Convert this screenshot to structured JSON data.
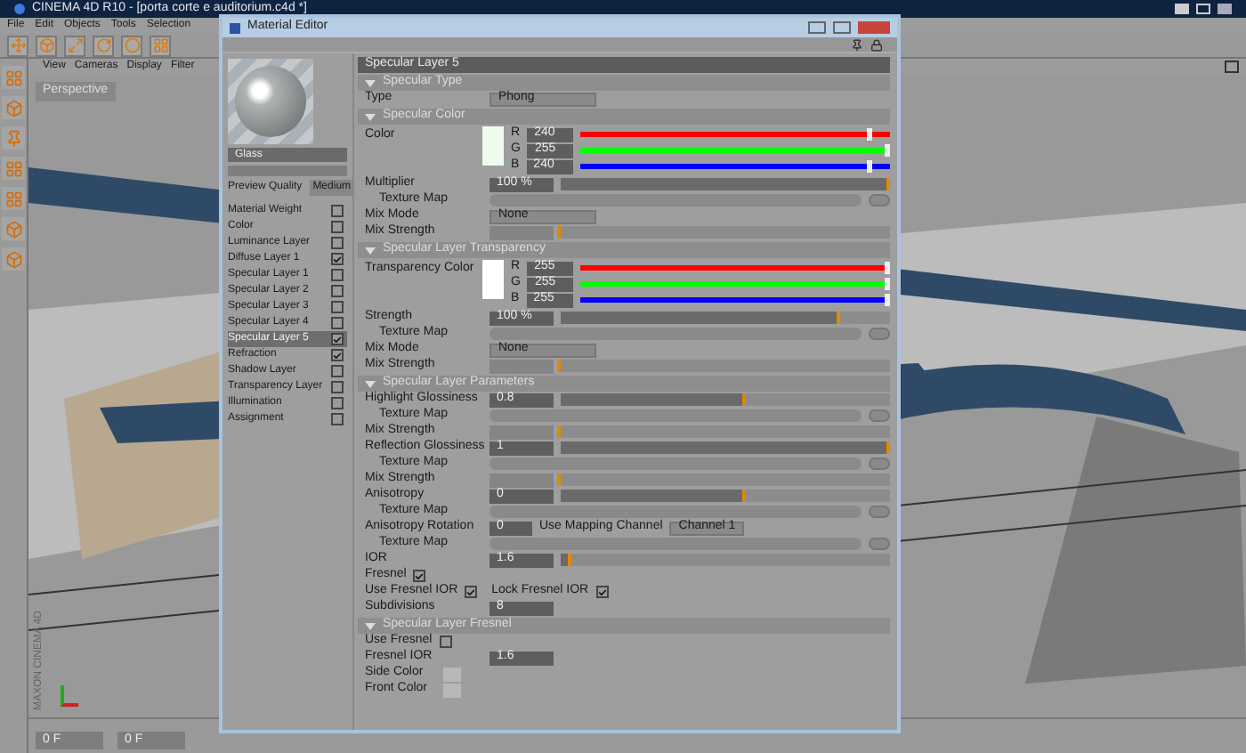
{
  "app": {
    "title": "CINEMA 4D R10 - [porta corte e auditorium.c4d *]",
    "menu": [
      "File",
      "Edit",
      "Objects",
      "Tools",
      "Selection"
    ]
  },
  "viewport": {
    "menu": [
      "View",
      "Cameras",
      "Display",
      "Filter"
    ],
    "label": "Perspective",
    "logo": "MAXON CINEMA 4D"
  },
  "timeline": {
    "current_frame": "0 F",
    "field_2": "0 F"
  },
  "editor": {
    "title": "Material Editor"
  },
  "preview": {
    "name": "Glass",
    "quality_label": "Preview Quality",
    "quality": "Medium"
  },
  "channels": [
    {
      "label": "Material Weight",
      "checked": false,
      "selected": false
    },
    {
      "label": "Color",
      "checked": false,
      "selected": false
    },
    {
      "label": "Luminance Layer",
      "checked": false,
      "selected": false
    },
    {
      "label": "Diffuse Layer 1",
      "checked": true,
      "selected": false
    },
    {
      "label": "Specular Layer 1",
      "checked": false,
      "selected": false
    },
    {
      "label": "Specular Layer 2",
      "checked": false,
      "selected": false
    },
    {
      "label": "Specular Layer 3",
      "checked": false,
      "selected": false
    },
    {
      "label": "Specular Layer 4",
      "checked": false,
      "selected": false
    },
    {
      "label": "Specular Layer 5",
      "checked": true,
      "selected": true
    },
    {
      "label": "Refraction",
      "checked": true,
      "selected": false
    },
    {
      "label": "Shadow Layer",
      "checked": false,
      "selected": false
    },
    {
      "label": "Transparency Layer",
      "checked": false,
      "selected": false
    },
    {
      "label": "Illumination",
      "checked": false,
      "selected": false
    },
    {
      "label": "Assignment",
      "checked": false,
      "selected": false
    }
  ],
  "panel": {
    "rows": [
      {
        "kind": "header",
        "label": "Specular Layer 5"
      },
      {
        "kind": "section",
        "label": "Specular Type"
      },
      {
        "kind": "dropdown",
        "label": "Type",
        "value": "Phong"
      },
      {
        "kind": "section",
        "label": "Specular Color"
      },
      {
        "kind": "color",
        "label": "Color",
        "color": "#eefcee",
        "channels": [
          {
            "name": "R",
            "value": "240",
            "level": 0.94,
            "color": "#ff0000"
          },
          {
            "name": "G",
            "value": "255",
            "level": 1,
            "color": "#00ff00"
          },
          {
            "name": "B",
            "value": "240",
            "level": 0.94,
            "color": "#0000ff"
          }
        ]
      },
      {
        "kind": "slider",
        "label": "Multiplier",
        "value": "100 %",
        "level": 1
      },
      {
        "kind": "texture",
        "label": "Texture Map"
      },
      {
        "kind": "dropdown",
        "label": "Mix Mode",
        "value": "None"
      },
      {
        "kind": "slider",
        "label": "Mix Strength",
        "level": 0
      },
      {
        "kind": "section",
        "label": "Specular Layer Transparency"
      },
      {
        "kind": "color",
        "label": "Transparency Color",
        "color": "#ffffff",
        "channels": [
          {
            "name": "R",
            "value": "255",
            "level": 1,
            "color": "#ff0000"
          },
          {
            "name": "G",
            "value": "255",
            "level": 1,
            "color": "#00ff00"
          },
          {
            "name": "B",
            "value": "255",
            "level": 1,
            "color": "#0000ff"
          }
        ]
      },
      {
        "kind": "slider",
        "label": "Strength",
        "value": "100 %",
        "level": 0.85
      },
      {
        "kind": "texture",
        "label": "Texture Map"
      },
      {
        "kind": "dropdown",
        "label": "Mix Mode",
        "value": "None"
      },
      {
        "kind": "slider",
        "label": "Mix Strength",
        "level": 0
      },
      {
        "kind": "section",
        "label": "Specular Layer Parameters"
      },
      {
        "kind": "slider",
        "label": "Highlight Glossiness",
        "value": "0.8",
        "level": 0.56
      },
      {
        "kind": "texture",
        "label": "Texture Map"
      },
      {
        "kind": "slider",
        "label": "Mix Strength",
        "level": 0
      },
      {
        "kind": "slider",
        "label": "Reflection Glossiness",
        "value": "1",
        "level": 1
      },
      {
        "kind": "texture",
        "label": "Texture Map"
      },
      {
        "kind": "slider",
        "label": "Mix Strength",
        "level": 0
      },
      {
        "kind": "slider",
        "label": "Anisotropy",
        "value": "0",
        "level": 0.56
      },
      {
        "kind": "texture",
        "label": "Texture Map"
      },
      {
        "kind": "pair",
        "label": "Anisotropy Rotation",
        "value": "0",
        "label2": "Use Mapping Channel",
        "value2": "Channel 1"
      },
      {
        "kind": "texture",
        "label": "Texture Map"
      },
      {
        "kind": "slider",
        "label": "IOR",
        "value": "1.6",
        "level": 0.03
      },
      {
        "kind": "checks",
        "items": [
          {
            "label": "Fresnel",
            "checked": true
          }
        ]
      },
      {
        "kind": "checks",
        "items": [
          {
            "label": "Use Fresnel IOR",
            "checked": true
          },
          {
            "label": "Lock Fresnel IOR",
            "checked": true
          }
        ]
      },
      {
        "kind": "field",
        "label": "Subdivisions",
        "value": "8"
      },
      {
        "kind": "section",
        "label": "Specular Layer Fresnel"
      },
      {
        "kind": "checks",
        "items": [
          {
            "label": "Use Fresnel",
            "checked": false
          }
        ]
      },
      {
        "kind": "field",
        "label": "Fresnel IOR",
        "value": "1.6"
      },
      {
        "kind": "swatch",
        "label": "Side Color",
        "color": "#b8b8b8"
      },
      {
        "kind": "swatch",
        "label": "Front Color",
        "color": "#b8b8b8"
      }
    ]
  }
}
